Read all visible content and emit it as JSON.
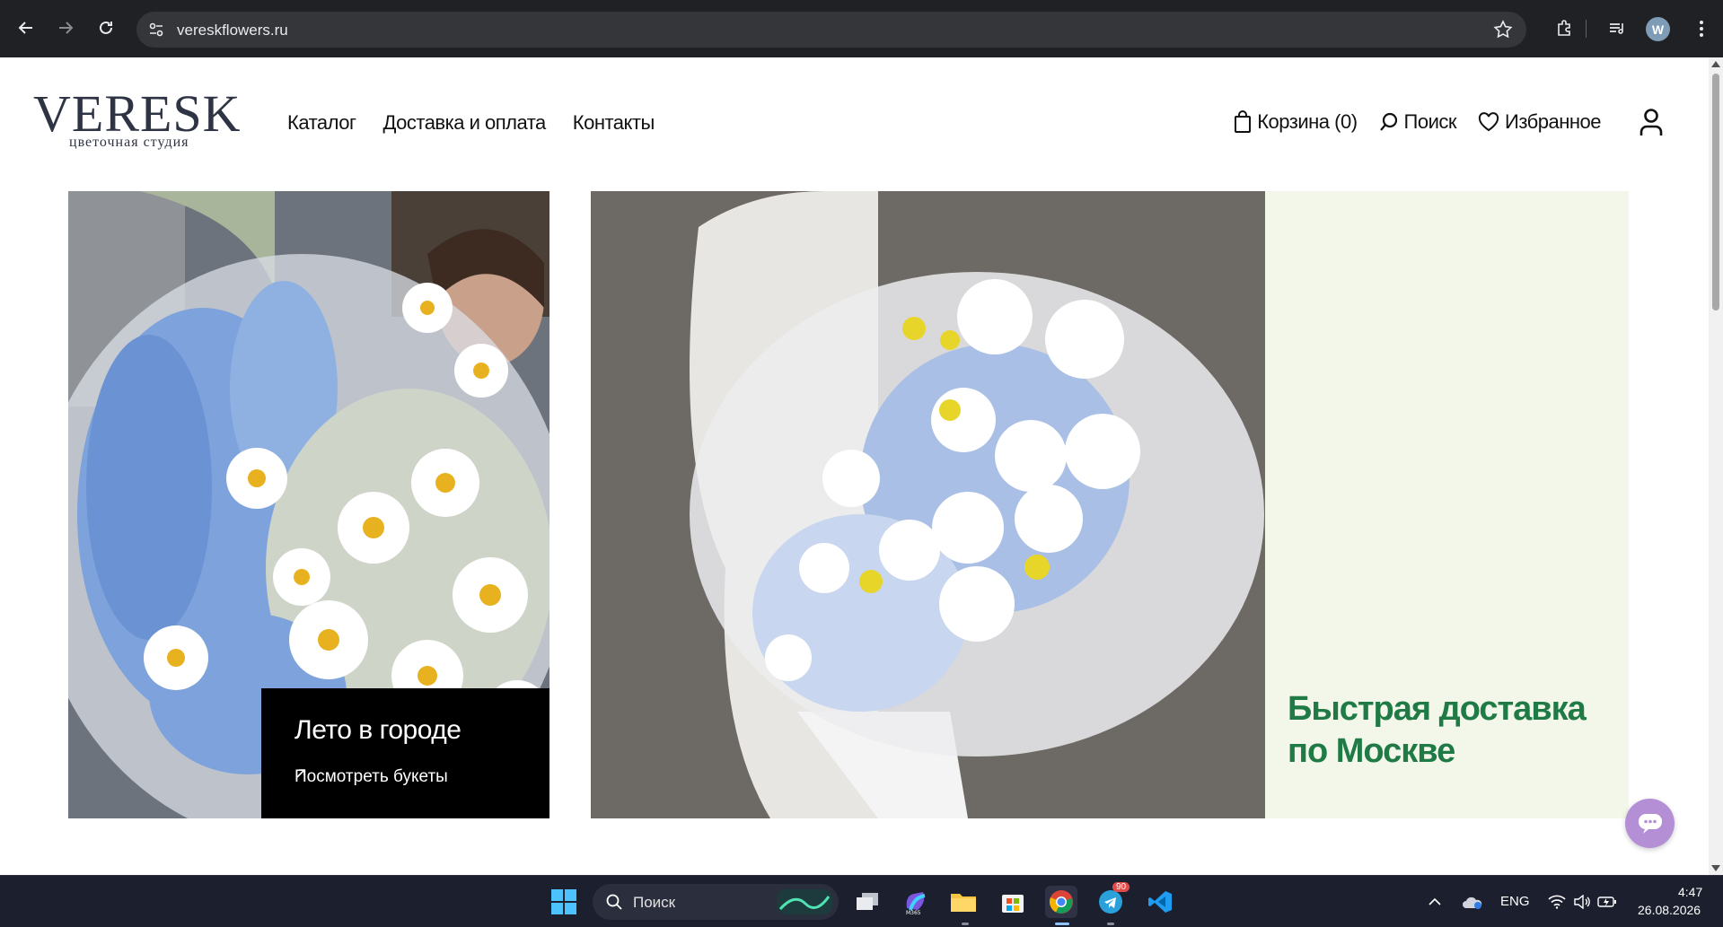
{
  "browser": {
    "url": "vereskflowers.ru",
    "profile_initial": "W"
  },
  "header": {
    "logo_brand": "VERESK",
    "logo_tagline": "цветочная студия",
    "nav": [
      "Каталог",
      "Доставка и оплата",
      "Контакты"
    ],
    "cart_label": "Корзина (0)",
    "search_label": "Поиск",
    "favorites_label": "Избранное"
  },
  "hero": {
    "promo_title": "Лето в городе",
    "promo_link": "Посмотреть букеты",
    "delivery_text": "Быстрая доставка по Москве",
    "colors": {
      "promo_bg": "#000000",
      "delivery_bg": "#f3f7e9",
      "delivery_text": "#1f7a45"
    }
  },
  "taskbar": {
    "search_label": "Поиск",
    "telegram_badge": "90",
    "lang": "ENG",
    "time": "4:47",
    "date": "26.08.2026",
    "apps": [
      "windows-start",
      "search",
      "widgets",
      "task-view",
      "m365",
      "file-explorer",
      "microsoft-store",
      "chrome",
      "telegram",
      "vscode"
    ]
  }
}
